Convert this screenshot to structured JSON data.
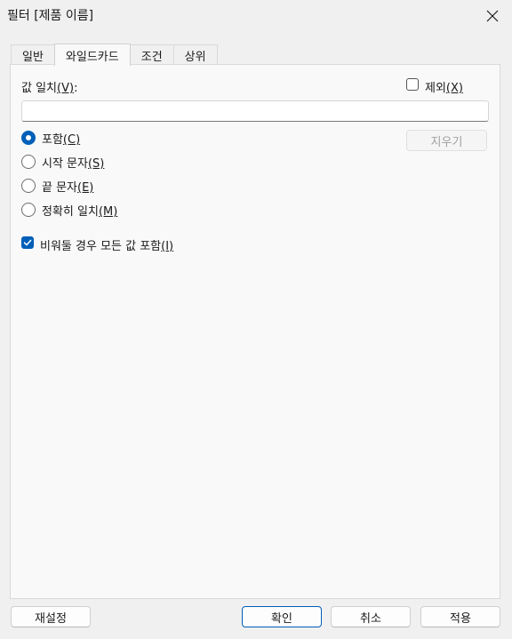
{
  "window": {
    "title": "필터 [제품 이름]"
  },
  "tabs": [
    {
      "label": "일반"
    },
    {
      "label": "와일드카드"
    },
    {
      "label": "조건"
    },
    {
      "label": "상위"
    }
  ],
  "wildcard": {
    "match_label": "값 일치",
    "match_label_suffix": ":",
    "match_mnemonic": "(V)",
    "match_value": "",
    "exclude_label": "제외",
    "exclude_mnemonic": "(X)",
    "exclude_checked": false,
    "clear_button": "지우기",
    "options": [
      {
        "label": "포함",
        "mnemonic": "(C)",
        "checked": true
      },
      {
        "label": "시작 문자",
        "mnemonic": "(S)",
        "checked": false
      },
      {
        "label": "끝 문자",
        "mnemonic": "(E)",
        "checked": false
      },
      {
        "label": "정확히 일치",
        "mnemonic": "(M)",
        "checked": false
      }
    ],
    "include_all_label": "비워둘 경우 모든 값 포함",
    "include_all_mnemonic": "(I)",
    "include_all_checked": true
  },
  "footer": {
    "reset": "재설정",
    "ok": "확인",
    "cancel": "취소",
    "apply": "적용"
  },
  "colors": {
    "accent": "#005fb8",
    "background": "#f0f0f0",
    "panel": "#f9f9f9"
  }
}
